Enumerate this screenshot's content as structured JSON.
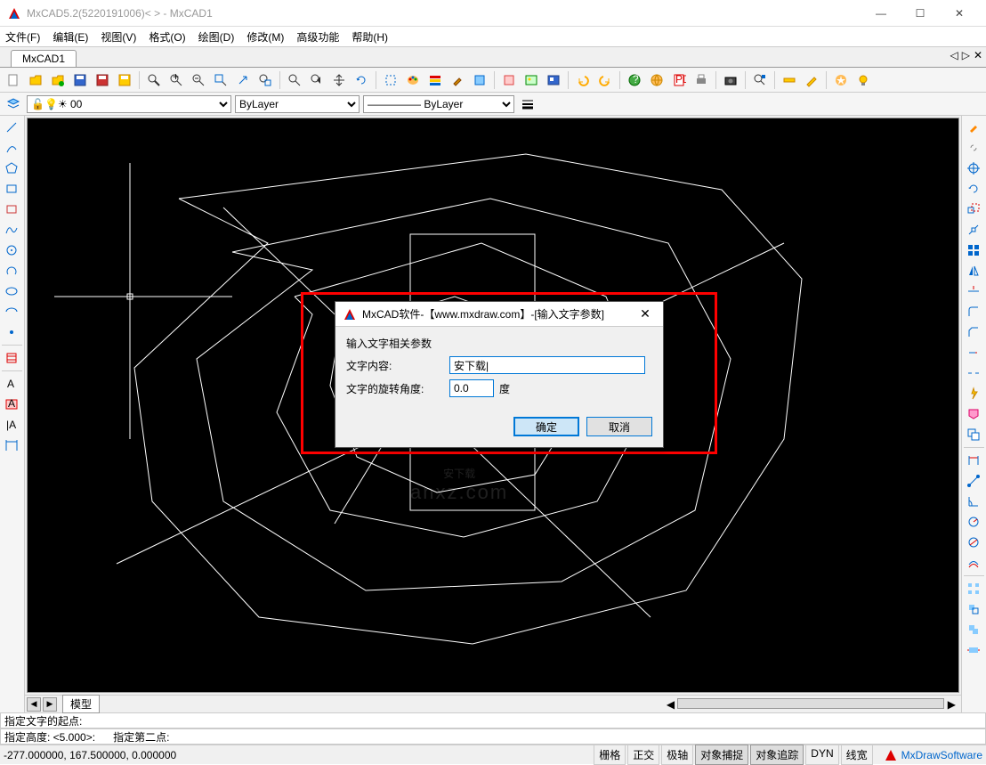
{
  "window": {
    "title": "MxCAD5.2(5220191006)< > - MxCAD1",
    "min": "—",
    "max": "☐",
    "close": "✕"
  },
  "menu": [
    "文件(F)",
    "编辑(E)",
    "视图(V)",
    "格式(O)",
    "绘图(D)",
    "修改(M)",
    "高级功能",
    "帮助(H)"
  ],
  "docTab": "MxCAD1",
  "tabNav": [
    "◁",
    "▷",
    "✕"
  ],
  "layerSelect": "0",
  "colorSelect": "ByLayer",
  "linetypeSelect": "ByLayer",
  "modelTab": "模型",
  "cmdHistory": "指定文字的起点:",
  "cmdPrompt1": "指定高度: <5.000>:",
  "cmdPrompt2": "指定第二点:",
  "coords": "-277.000000,  167.500000,  0.000000",
  "statusButtons": [
    "栅格",
    "正交",
    "极轴",
    "对象捕捉",
    "对象追踪",
    "DYN",
    "线宽"
  ],
  "statusLogo": "MxDrawSoftware",
  "dialog": {
    "title": "MxCAD软件-【www.mxdraw.com】-[输入文字参数]",
    "group": "输入文字相关参数",
    "label1": "文字内容:",
    "value1": "安下载|",
    "label2": "文字的旋转角度:",
    "value2": "0.0",
    "unit": "度",
    "ok": "确定",
    "cancel": "取消"
  },
  "watermark": {
    "main": "安下载",
    "sub": "anxz.com"
  },
  "toolbar1_icons": [
    "new",
    "open",
    "save",
    "saveas",
    "import",
    "export",
    "zoom-in",
    "zoom-out",
    "zoom-window",
    "zoom-extents",
    "zoom-prev",
    "pan",
    "zoom-realtime",
    "refresh",
    "select",
    "isolate",
    "layers",
    "colors",
    "hatch",
    "brush",
    "block",
    "insert",
    "image",
    "ole",
    "undo",
    "redo",
    "help",
    "web",
    "pdf",
    "print",
    "camera",
    "find",
    "ruler",
    "edit",
    "star",
    "bulb"
  ],
  "left_icons": [
    "line",
    "arc",
    "polygon",
    "rectangle",
    "rect-round",
    "spline",
    "circle",
    "circle-arc",
    "ellipse",
    "ellipse-arc",
    "point",
    "hatch-tool",
    "text-a",
    "mtext",
    "text-vert",
    "dimension"
  ],
  "right_icons": [
    "brush-edit",
    "link",
    "target",
    "rotate",
    "scale-box",
    "scale",
    "grid-move",
    "mirror",
    "trim",
    "fillet",
    "chamfer",
    "extend",
    "break",
    "quick",
    "region",
    "copy-rect",
    "line-dim",
    "measure",
    "angle",
    "radius",
    "diameter",
    "offset",
    "array",
    "move",
    "copy",
    "stretch"
  ]
}
